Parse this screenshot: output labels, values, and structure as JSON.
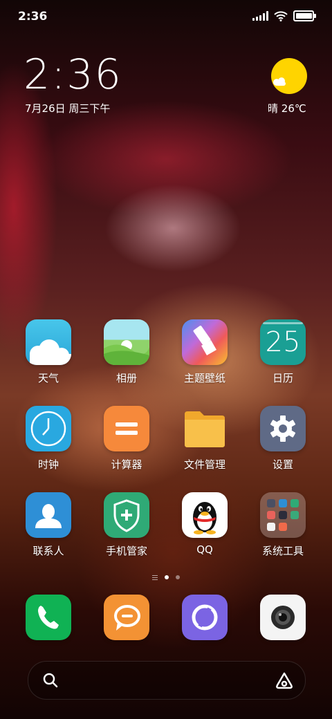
{
  "status_bar": {
    "time": "2:36",
    "battery_level": 0.9
  },
  "clock_widget": {
    "time": "2:36",
    "date": "7月26日 周三下午"
  },
  "weather_widget": {
    "condition": "晴",
    "temperature": "26℃"
  },
  "apps": [
    {
      "label": "天气",
      "icon": "weather-icon"
    },
    {
      "label": "相册",
      "icon": "gallery-icon"
    },
    {
      "label": "主题壁纸",
      "icon": "theme-brush-icon"
    },
    {
      "label": "日历",
      "icon": "calendar-icon",
      "day": "25"
    },
    {
      "label": "时钟",
      "icon": "clock-icon"
    },
    {
      "label": "计算器",
      "icon": "calculator-icon"
    },
    {
      "label": "文件管理",
      "icon": "folder-icon"
    },
    {
      "label": "设置",
      "icon": "gear-icon"
    },
    {
      "label": "联系人",
      "icon": "contact-icon"
    },
    {
      "label": "手机管家",
      "icon": "shield-plus-icon"
    },
    {
      "label": "QQ",
      "icon": "qq-penguin-icon"
    },
    {
      "label": "系统工具",
      "icon": "folder-grid-icon"
    }
  ],
  "page_indicator": {
    "pages": 2,
    "current": 1
  },
  "dock": [
    {
      "icon": "phone-icon"
    },
    {
      "icon": "message-icon"
    },
    {
      "icon": "browser-icon"
    },
    {
      "icon": "camera-icon"
    }
  ],
  "search": {
    "placeholder": ""
  },
  "colors": {
    "weather_bg": "#3bb7df",
    "gallery_bg": "#8fd36b",
    "theme_bg": "#e8625b",
    "calendar_bg": "#1a9f94",
    "clock_bg": "#29a8e0",
    "calculator_bg": "#f6893b",
    "folder_bg": "#f6b73c",
    "settings_bg": "#5f6a86",
    "contacts_bg": "#2e8fd6",
    "security_bg": "#2faa76",
    "phone_bg": "#10b254",
    "message_bg": "#f39234",
    "browser_bg": "#7b64e3",
    "camera_bg": "#f4f4f4",
    "sun": "#ffd400"
  }
}
